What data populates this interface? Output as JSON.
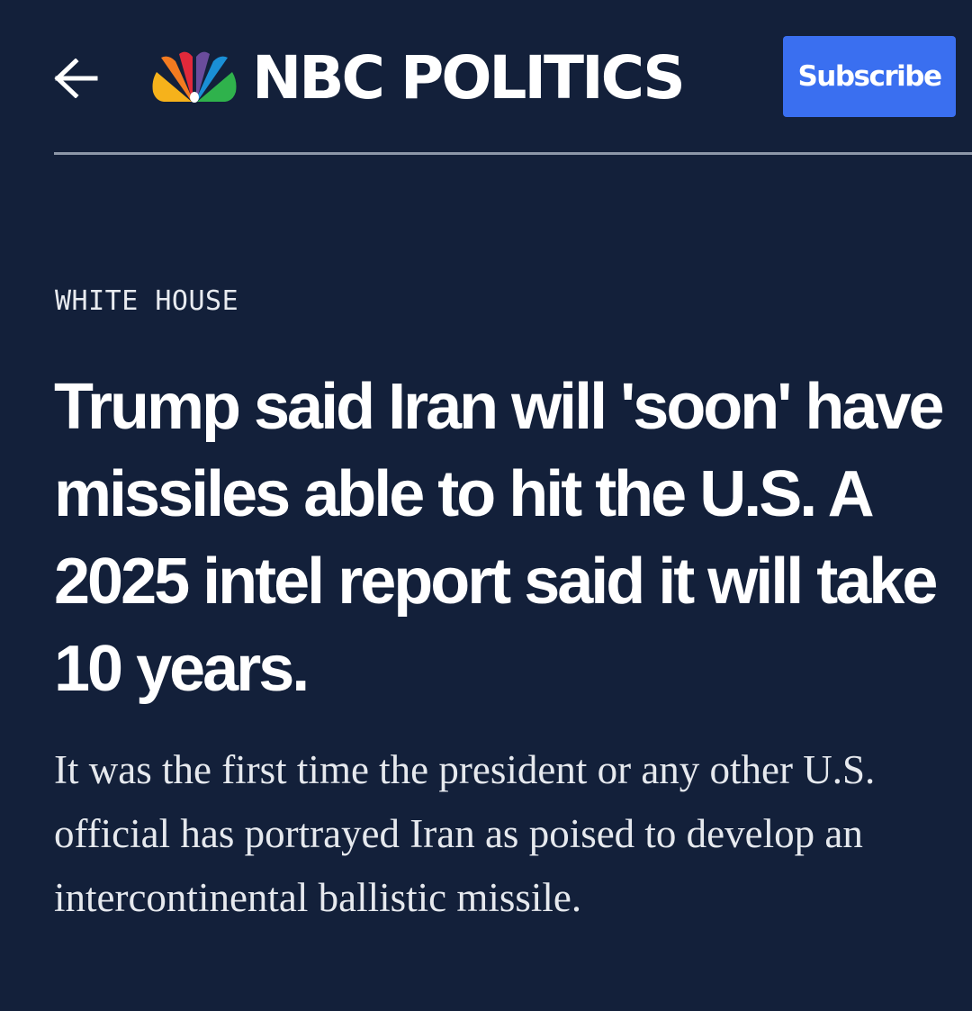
{
  "header": {
    "back_icon": "arrow-left-icon",
    "logo_icon": "nbc-peacock-icon",
    "brand": "NBC POLITICS",
    "subscribe_label": "Subscribe"
  },
  "article": {
    "section": "WHITE HOUSE",
    "headline": "Trump said Iran will 'soon' have missiles able to hit the U.S. A 2025 intel report said it will take 10 years.",
    "dek": "It was the first time the president or any other U.S. official has portrayed Iran as poised to develop an intercontinental ballistic missile."
  },
  "colors": {
    "background": "#13203a",
    "subscribe": "#3a6ff0",
    "divider": "#8d97a8",
    "peacock": [
      "#f6b21b",
      "#f47b20",
      "#e2293a",
      "#6a4c9c",
      "#1a8fd6",
      "#2fb24c"
    ]
  }
}
